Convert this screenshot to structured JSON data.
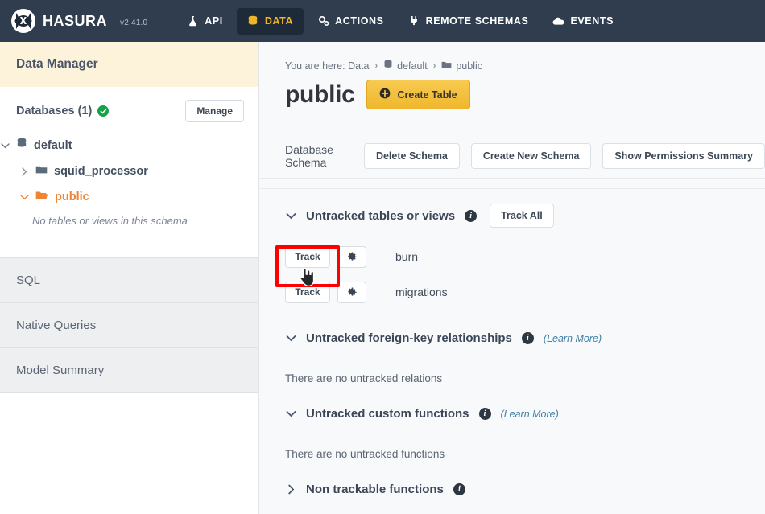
{
  "topnav": {
    "brand": "HASURA",
    "version": "v2.41.0",
    "items": [
      {
        "label": "API",
        "icon": "flask-icon",
        "active": false
      },
      {
        "label": "DATA",
        "icon": "database-icon",
        "active": true
      },
      {
        "label": "ACTIONS",
        "icon": "gears-icon",
        "active": false
      },
      {
        "label": "REMOTE SCHEMAS",
        "icon": "plug-icon",
        "active": false
      },
      {
        "label": "EVENTS",
        "icon": "cloud-icon",
        "active": false
      }
    ],
    "active_background": "#1f2a38",
    "active_color": "#f0b429",
    "background": "#2f3d4f"
  },
  "sidebar": {
    "header": "Data Manager",
    "header_background": "#fdf3da",
    "databases_label": "Databases (1)",
    "status_icon": "green-check-icon",
    "status_color": "#18a148",
    "manage_button": "Manage",
    "tree": [
      {
        "label": "default",
        "icon": "database-icon",
        "chevron": "chevron-down-icon",
        "level": 0,
        "selected": false
      },
      {
        "label": "squid_processor",
        "icon": "folder-closed-icon",
        "chevron": "chevron-right-icon",
        "level": 1,
        "selected": false
      },
      {
        "label": "public",
        "icon": "folder-open-icon",
        "chevron": "chevron-down-icon",
        "level": 1,
        "selected": true
      }
    ],
    "empty_message": "No tables or views in this schema",
    "nav_items": [
      {
        "label": "SQL"
      },
      {
        "label": "Native Queries"
      },
      {
        "label": "Model Summary"
      }
    ],
    "selected_color": "#ef8436"
  },
  "main": {
    "breadcrumb": {
      "prefix": "You are here: Data",
      "separator": "›",
      "items": [
        {
          "label": "default",
          "icon": "database-icon"
        },
        {
          "label": "public",
          "icon": "folder-closed-icon"
        }
      ]
    },
    "page_title": "public",
    "create_table_button": {
      "label": "Create Table",
      "icon": "plus-circle-icon",
      "color": "#f0b72e"
    },
    "schema_row": {
      "label": "Database Schema",
      "buttons": [
        {
          "label": "Delete Schema"
        },
        {
          "label": "Create New Schema"
        },
        {
          "label": "Show Permissions Summary"
        }
      ]
    },
    "sections": {
      "untracked_tables": {
        "title": "Untracked tables or views",
        "chevron": "chevron-down-icon",
        "info_icon": "info-icon",
        "track_all_button": "Track All",
        "rows": [
          {
            "track_label": "Track",
            "gear_icon": "gear-icon",
            "name": "burn"
          },
          {
            "track_label": "Track",
            "gear_icon": "gear-icon",
            "name": "migrations"
          }
        ]
      },
      "untracked_fk": {
        "title": "Untracked foreign-key relationships",
        "chevron": "chevron-down-icon",
        "info_icon": "info-icon",
        "learn_more": "(Learn More)",
        "empty_message": "There are no untracked relations"
      },
      "untracked_functions": {
        "title": "Untracked custom functions",
        "chevron": "chevron-down-icon",
        "info_icon": "info-icon",
        "learn_more": "(Learn More)",
        "empty_message": "There are no untracked functions"
      },
      "non_trackable_functions": {
        "title": "Non trackable functions",
        "chevron": "chevron-right-icon",
        "info_icon": "info-icon"
      }
    }
  },
  "annotation": {
    "type": "highlight-rectangle",
    "color": "#fe0000",
    "target": "track-button-burn",
    "cursor": "pointing-hand-cursor"
  }
}
